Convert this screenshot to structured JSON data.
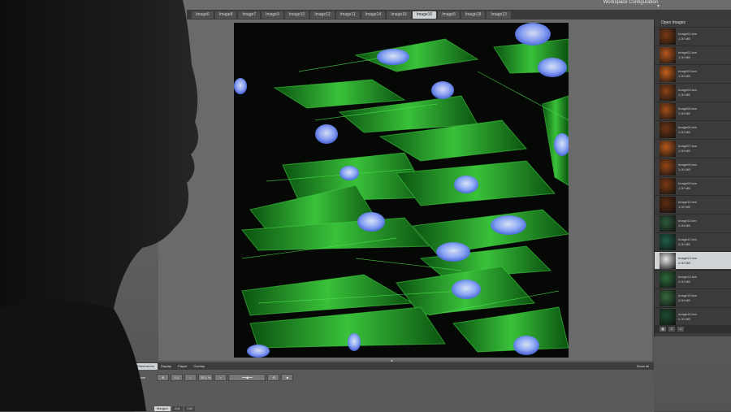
{
  "workspace": {
    "label": "Workspace Configuration"
  },
  "tabs": [
    {
      "label": "Image6"
    },
    {
      "label": "Image8"
    },
    {
      "label": "Image7"
    },
    {
      "label": "Image9"
    },
    {
      "label": "Image10"
    },
    {
      "label": "Image12"
    },
    {
      "label": "Image11"
    },
    {
      "label": "Image14"
    },
    {
      "label": "Image15"
    },
    {
      "label": "Image16"
    },
    {
      "label": "Image5"
    },
    {
      "label": "Image18"
    },
    {
      "label": "Image13"
    }
  ],
  "open_images": {
    "title": "Open Images",
    "items": [
      {
        "name": "Image01.lsm",
        "size": "1.00 MB"
      },
      {
        "name": "Image02.lsm",
        "size": "1.00 MB"
      },
      {
        "name": "Image03.lsm",
        "size": "1.00 MB"
      },
      {
        "name": "Image04.lsm",
        "size": "1.00 MB"
      },
      {
        "name": "Image05.lsm",
        "size": "1.00 MB"
      },
      {
        "name": "Image06.lsm",
        "size": "1.00 MB"
      },
      {
        "name": "Image07.lsm",
        "size": "1.00 MB"
      },
      {
        "name": "Image08.lsm",
        "size": "1.00 MB"
      },
      {
        "name": "Image09.lsm",
        "size": "1.00 MB"
      },
      {
        "name": "Image10.lsm",
        "size": "1.00 MB"
      },
      {
        "name": "Image11.lsm",
        "size": "2.00 MB"
      },
      {
        "name": "Image12.lsm",
        "size": "2.00 MB"
      },
      {
        "name": "Image13.lsm",
        "size": "2.00 MB"
      },
      {
        "name": "Image14.lsm",
        "size": "2.00 MB"
      },
      {
        "name": "Image15.lsm",
        "size": "2.00 MB"
      },
      {
        "name": "Image16.lsm",
        "size": "2.00 MB"
      }
    ]
  },
  "bottom": {
    "tabs": [
      {
        "label": "Dimensions"
      },
      {
        "label": "Display"
      },
      {
        "label": "Player"
      },
      {
        "label": "Overlay"
      }
    ],
    "show_all": "Show all",
    "zoom_label": "Zoom",
    "zoom_value": "25.1 %",
    "channels": [
      {
        "label": "Merged"
      },
      {
        "label": "Ch1"
      },
      {
        "label": "Ch2"
      }
    ]
  },
  "colors": {
    "actin": "#33c433",
    "nuclei": "#5a7bff",
    "panel": "#3b3b3b"
  }
}
